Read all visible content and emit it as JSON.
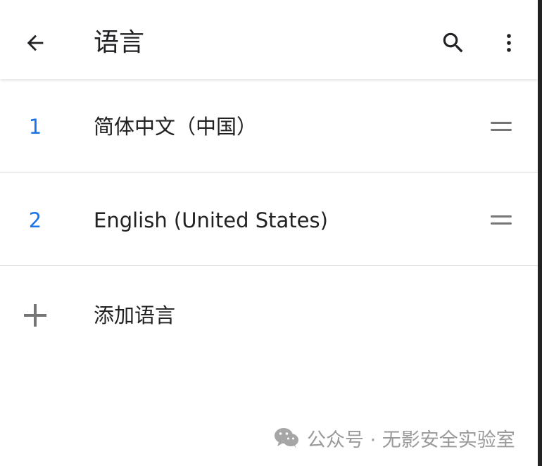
{
  "toolbar": {
    "title": "语言",
    "icons": {
      "back": "arrow-left-icon",
      "search": "search-icon",
      "more": "more-vertical-icon"
    }
  },
  "languages": [
    {
      "rank": "1",
      "label": "简体中文（中国）"
    },
    {
      "rank": "2",
      "label": "English (United States)"
    }
  ],
  "add_language": {
    "label": "添加语言",
    "icon": "plus-icon"
  },
  "watermark": {
    "text": "公众号 · 无影安全实验室",
    "icon": "wechat-icon"
  },
  "colors": {
    "accent": "#1a73e8",
    "text": "#222222",
    "divider": "#d8d8d8",
    "watermark": "#9a9a9a"
  }
}
